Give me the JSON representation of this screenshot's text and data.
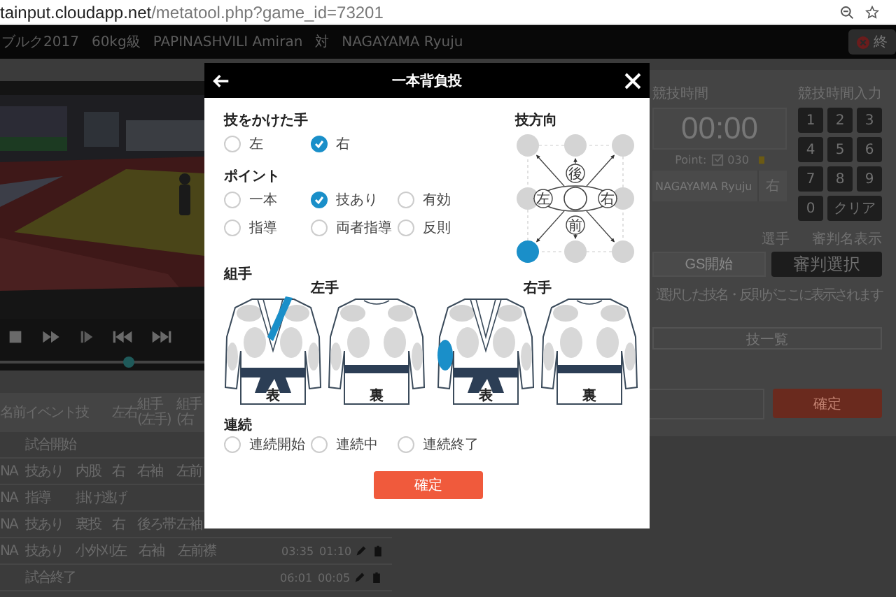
{
  "browser": {
    "url_host": "tainput.cloudapp.net",
    "url_path": "/metatool.php?game_id=73201"
  },
  "match_bar": {
    "items": [
      "ブルク2017",
      "60kg級",
      "PAPINASHVILI Amiran",
      "対",
      "NAGAYAMA Ryuju"
    ],
    "end_button": "終"
  },
  "video": {
    "seek": {
      "level": 0.33
    }
  },
  "table": {
    "columns": [
      "名前",
      "イベント",
      "技",
      "左右",
      "組手\n(左手)",
      "組手\n(右"
    ],
    "rows": [
      {
        "event": "試合開始"
      },
      {
        "name": "NA",
        "event": "技あり",
        "technique": "内股",
        "side": "右",
        "grip_left": "右袖",
        "grip_right": "左前"
      },
      {
        "name": "NA",
        "event": "指導",
        "technique": "掛け逃げ"
      },
      {
        "name": "NA",
        "event": "技あり",
        "technique": "裏投",
        "side": "右",
        "grip_left": "後ろ帯",
        "grip_right": "左袖"
      },
      {
        "name": "NA",
        "event": "技あり",
        "technique": "小外刈",
        "side": "左",
        "grip_left": "右袖",
        "grip_right": "左前襟",
        "time_1": "03:35",
        "time_2": "01:10"
      },
      {
        "event": "試合終了",
        "time_1": "06:01",
        "time_2": "00:05"
      }
    ]
  },
  "side_panel": {
    "time_label": "競技時間",
    "time": "00:00",
    "point_label": "Point:",
    "point_value": "030",
    "player": "NAGAYAMA Ryuju",
    "player_side": "右",
    "keypad_label": "競技時間入力",
    "keys": [
      "1",
      "2",
      "3",
      "4",
      "5",
      "6",
      "7",
      "8",
      "9",
      "0",
      "クリア"
    ],
    "player_label": "選手",
    "referee_label": "審判名表示",
    "gs_button": "GS開始",
    "referee_button": "審判選択",
    "message": "選択した技名・反則がここに表示されます",
    "technique_list_button": "技一覧",
    "confirm_button": "確定"
  },
  "modal": {
    "title": "一本背負投",
    "hand": {
      "label": "技をかけた手",
      "options": [
        {
          "label": "左",
          "selected": false
        },
        {
          "label": "右",
          "selected": true
        }
      ]
    },
    "point": {
      "label": "ポイント",
      "options": [
        {
          "label": "一本",
          "selected": false
        },
        {
          "label": "技あり",
          "selected": true
        },
        {
          "label": "有効",
          "selected": false
        },
        {
          "label": "指導",
          "selected": false
        },
        {
          "label": "両者指導",
          "selected": false
        },
        {
          "label": "反則",
          "selected": false
        }
      ]
    },
    "direction": {
      "label": "技方向",
      "back": "後",
      "left": "左",
      "right": "右",
      "front": "前",
      "options": [
        {
          "selected": false
        },
        {
          "selected": false
        },
        {
          "selected": false
        },
        {
          "selected": false
        },
        {
          "selected": false
        },
        {
          "selected": true
        },
        {
          "selected": false
        },
        {
          "selected": false
        }
      ]
    },
    "grip": {
      "label": "組手",
      "hands": [
        {
          "label": "左手",
          "views": [
            {
              "label": "表",
              "kind": "front",
              "grips": [
                {
                  "kind": "lapel"
                }
              ]
            },
            {
              "label": "裏",
              "kind": "back"
            }
          ]
        },
        {
          "label": "右手",
          "views": [
            {
              "label": "表",
              "kind": "front",
              "grips": [
                {
                  "kind": "sleeve"
                }
              ]
            },
            {
              "label": "裏",
              "kind": "back"
            }
          ]
        }
      ]
    },
    "sequence": {
      "label": "連続",
      "options": [
        {
          "label": "連続開始",
          "selected": false
        },
        {
          "label": "連続中",
          "selected": false
        },
        {
          "label": "連続終了",
          "selected": false
        }
      ]
    },
    "confirm": "確定"
  }
}
